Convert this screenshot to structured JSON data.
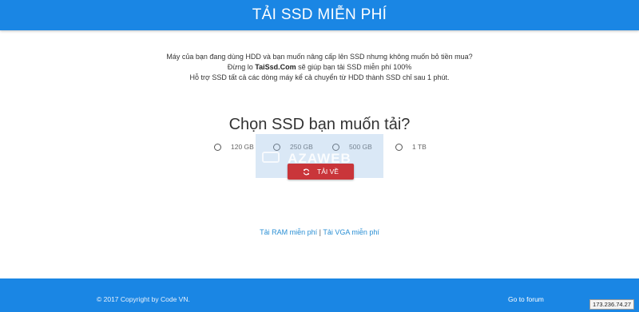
{
  "header": {
    "title": "TẢI SSD MIỄN PHÍ"
  },
  "intro": {
    "line1": "Máy của bạn đang dùng HDD và bạn muốn nâng cấp lên SSD nhưng không muốn bỏ tiền mua?",
    "line2_prefix": "Đừng lo ",
    "line2_brand": "TaiSsd.Com",
    "line2_suffix": " sẽ giúp bạn tải SSD miễn phí 100%",
    "line3": "Hỗ trợ SSD tất cả các dòng máy kể cả chuyển từ HDD thành SSD chỉ sau 1 phút."
  },
  "chooser": {
    "title": "Chọn SSD bạn muốn tải?",
    "options": [
      "120 GB",
      "250 GB",
      "500 GB",
      "1 TB"
    ]
  },
  "watermark": {
    "text": "AZAWEB"
  },
  "download_button": {
    "label": "TẢI VỀ",
    "icon": "refresh-icon",
    "color": "#c9353a"
  },
  "links": {
    "ram": "Tải RAM miễn phí",
    "separator": " | ",
    "vga": "Tải VGA miễn phí"
  },
  "footer": {
    "copyright": "© 2017 Copyright by Code VN.",
    "forum": "Go to forum"
  },
  "ip_badge": "173.236.74.27",
  "colors": {
    "header_bg": "#1a86e4",
    "footer_bg": "#1a86e4",
    "link": "#2a8fd4",
    "button": "#c9353a"
  }
}
